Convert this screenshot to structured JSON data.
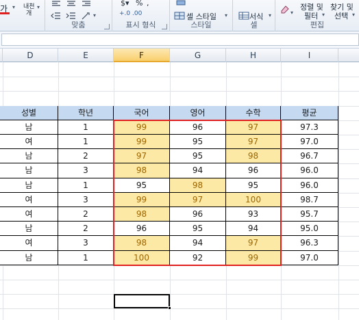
{
  "ribbon": {
    "font": {
      "font_glyph": "가",
      "phonetic_label": "내천",
      "phonetic_label_bottom": "개"
    },
    "alignment": {
      "label": "맞춤"
    },
    "number": {
      "label": "표시 형식",
      "percent": "%",
      "comma": ",",
      "inc_decimal": "+.0 .00",
      "dec_decimal": ".00 →.0"
    },
    "styles": {
      "cell_styles": "셀 스타일",
      "label": "스타일"
    },
    "cells": {
      "format": "서식",
      "label": "셀"
    },
    "editing": {
      "sort_filter_top": "정렬 및",
      "sort_filter_bottom": "필터",
      "find_select_top": "찾기 및",
      "find_select_bottom": "선택",
      "label": "편집"
    }
  },
  "columns": [
    "D",
    "E",
    "F",
    "G",
    "H",
    "I"
  ],
  "table": {
    "headers": [
      "성별",
      "학년",
      "국어",
      "영어",
      "수학",
      "평균"
    ],
    "rows": [
      [
        "남",
        "1",
        "99",
        "96",
        "97",
        "97.3"
      ],
      [
        "여",
        "1",
        "99",
        "95",
        "97",
        "97.0"
      ],
      [
        "남",
        "2",
        "97",
        "95",
        "98",
        "96.7"
      ],
      [
        "남",
        "3",
        "98",
        "94",
        "96",
        "96.0"
      ],
      [
        "남",
        "1",
        "95",
        "98",
        "95",
        "96.0"
      ],
      [
        "여",
        "3",
        "99",
        "97",
        "100",
        "98.7"
      ],
      [
        "여",
        "2",
        "98",
        "96",
        "93",
        "95.7"
      ],
      [
        "남",
        "2",
        "96",
        "95",
        "94",
        "95.0"
      ],
      [
        "여",
        "3",
        "98",
        "94",
        "97",
        "96.3"
      ],
      [
        "남",
        "1",
        "100",
        "92",
        "99",
        "97.0"
      ]
    ],
    "highlighted": [
      [
        false,
        false,
        true,
        false,
        true,
        false
      ],
      [
        false,
        false,
        true,
        false,
        true,
        false
      ],
      [
        false,
        false,
        true,
        false,
        true,
        false
      ],
      [
        false,
        false,
        true,
        false,
        false,
        false
      ],
      [
        false,
        false,
        false,
        true,
        false,
        false
      ],
      [
        false,
        false,
        true,
        true,
        true,
        false
      ],
      [
        false,
        false,
        true,
        false,
        false,
        false
      ],
      [
        false,
        false,
        false,
        false,
        false,
        false
      ],
      [
        false,
        false,
        true,
        false,
        true,
        false
      ],
      [
        false,
        false,
        true,
        false,
        true,
        false
      ]
    ]
  },
  "colors": {
    "highlight_fill": "#fde9a6",
    "highlight_text": "#9c6500",
    "header_fill": "#c5d9f1",
    "selection_border": "#e01e1e"
  }
}
